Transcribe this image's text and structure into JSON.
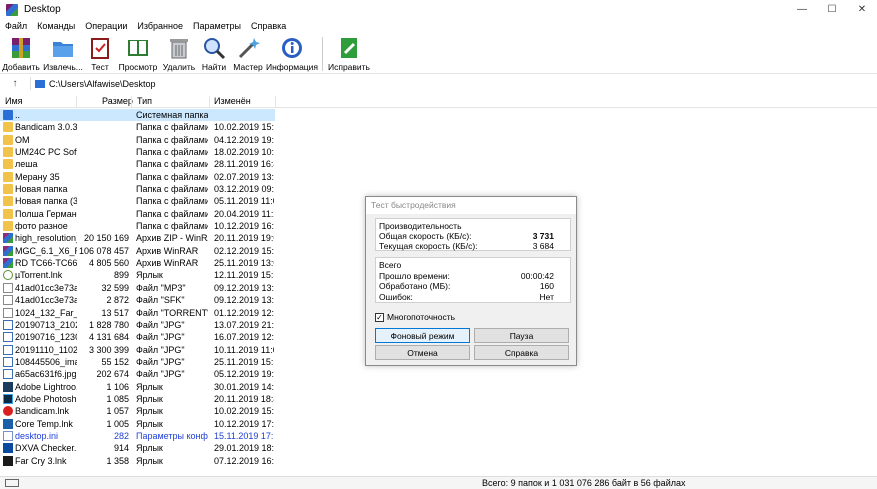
{
  "window": {
    "title": "Desktop",
    "controls": {
      "minimize": "—",
      "maximize": "☐",
      "close": "✕"
    }
  },
  "menu": [
    "Файл",
    "Команды",
    "Операции",
    "Избранное",
    "Параметры",
    "Справка"
  ],
  "toolbar": [
    {
      "label": "Добавить",
      "icon": "archive-add-icon"
    },
    {
      "label": "Извлечь...",
      "icon": "extract-folder-icon"
    },
    {
      "label": "Тест",
      "icon": "test-clipboard-icon"
    },
    {
      "label": "Просмотр",
      "icon": "view-book-icon"
    },
    {
      "label": "Удалить",
      "icon": "trash-icon"
    },
    {
      "label": "Найти",
      "icon": "magnifier-icon"
    },
    {
      "label": "Мастер",
      "icon": "wizard-wand-icon"
    },
    {
      "label": "Информация",
      "icon": "info-icon"
    },
    {
      "label": "Исправить",
      "icon": "repair-icon"
    }
  ],
  "address": {
    "path": "C:\\Users\\Alfawise\\Desktop",
    "up_glyph": "↑"
  },
  "columns": {
    "name": "Имя",
    "size": "Размер",
    "type": "Тип",
    "modified": "Изменён"
  },
  "files": [
    {
      "name": "..",
      "size": "",
      "type": "Системная папка",
      "date": "",
      "icon": "folder-up-icon"
    },
    {
      "name": "Bandicam 3.0.3....",
      "size": "",
      "type": "Папка с файлами",
      "date": "10.02.2019 15:43",
      "icon": "folder-icon"
    },
    {
      "name": "OM",
      "size": "",
      "type": "Папка с файлами",
      "date": "04.12.2019 19:21",
      "icon": "folder-icon"
    },
    {
      "name": "UM24C PC Soft...",
      "size": "",
      "type": "Папка с файлами",
      "date": "18.02.2019 10:10",
      "icon": "folder-icon"
    },
    {
      "name": "леша",
      "size": "",
      "type": "Папка с файлами",
      "date": "28.11.2019 16:44",
      "icon": "folder-icon"
    },
    {
      "name": "Мерану 35",
      "size": "",
      "type": "Папка с файлами",
      "date": "02.07.2019 13:15",
      "icon": "folder-icon"
    },
    {
      "name": "Новая папка",
      "size": "",
      "type": "Папка с файлами",
      "date": "03.12.2019 09:15",
      "icon": "folder-icon"
    },
    {
      "name": "Новая папка (3)",
      "size": "",
      "type": "Папка с файлами",
      "date": "05.11.2019 11:08",
      "icon": "folder-icon"
    },
    {
      "name": "Полша Герман...",
      "size": "",
      "type": "Папка с файлами",
      "date": "20.04.2019 11:26",
      "icon": "folder-icon"
    },
    {
      "name": "фото разное",
      "size": "",
      "type": "Папка с файлами",
      "date": "10.12.2019 16:59",
      "icon": "folder-icon"
    },
    {
      "name": "high_resolution_...",
      "size": "20 150 169",
      "type": "Архив ZIP - WinRAR",
      "date": "20.11.2019 19:07",
      "icon": "winrar-archive-icon"
    },
    {
      "name": "MGC_6.1_X6_RN...",
      "size": "106 078 457",
      "type": "Архив WinRAR",
      "date": "02.12.2019 15:02",
      "icon": "winrar-archive-icon"
    },
    {
      "name": "RD TC66-TC66C ...",
      "size": "4 805 560",
      "type": "Архив WinRAR",
      "date": "25.11.2019 13:02",
      "icon": "winrar-archive-icon"
    },
    {
      "name": "µTorrent.lnk",
      "size": "899",
      "type": "Ярлык",
      "date": "12.11.2019 15:50",
      "icon": "utorrent-icon"
    },
    {
      "name": "41ad01cc3e73a1...",
      "size": "32 599",
      "type": "Файл \"MP3\"",
      "date": "09.12.2019 13:33",
      "icon": "file-icon"
    },
    {
      "name": "41ad01cc3e73a1...",
      "size": "2 872",
      "type": "Файл \"SFK\"",
      "date": "09.12.2019 13:33",
      "icon": "file-icon"
    },
    {
      "name": "1024_132_Far_Cr...",
      "size": "13 517",
      "type": "Файл \"TORRENT\"",
      "date": "01.12.2019 12:33",
      "icon": "torrent-file-icon"
    },
    {
      "name": "20190713_21022...",
      "size": "1 828 780",
      "type": "Файл \"JPG\"",
      "date": "13.07.2019 21:02",
      "icon": "image-icon"
    },
    {
      "name": "20190716_12302...",
      "size": "4 131 684",
      "type": "Файл \"JPG\"",
      "date": "16.07.2019 12:30",
      "icon": "image-icon"
    },
    {
      "name": "20191110_11022...",
      "size": "3 300 399",
      "type": "Файл \"JPG\"",
      "date": "10.11.2019 11:02",
      "icon": "image-icon"
    },
    {
      "name": "108445506_imag...",
      "size": "55 152",
      "type": "Файл \"JPG\"",
      "date": "25.11.2019 15:56",
      "icon": "image-icon"
    },
    {
      "name": "a65ac631f6.jpg",
      "size": "202 674",
      "type": "Файл \"JPG\"",
      "date": "05.12.2019 19:57",
      "icon": "image-icon"
    },
    {
      "name": "Adobe Lightroo...",
      "size": "1 106",
      "type": "Ярлык",
      "date": "30.01.2019 14:08",
      "icon": "lightroom-icon"
    },
    {
      "name": "Adobe Photosh...",
      "size": "1 085",
      "type": "Ярлык",
      "date": "20.11.2019 18:44",
      "icon": "photoshop-icon"
    },
    {
      "name": "Bandicam.lnk",
      "size": "1 057",
      "type": "Ярлык",
      "date": "10.02.2019 15:45",
      "icon": "bandicam-icon"
    },
    {
      "name": "Core Temp.lnk",
      "size": "1 005",
      "type": "Ярлык",
      "date": "10.12.2019 17:20",
      "icon": "coretemp-icon"
    },
    {
      "name": "desktop.ini",
      "size": "282",
      "type": "Параметры конф...",
      "date": "15.11.2019 17:16",
      "icon": "ini-file-icon",
      "highlight": "#1f3fd6"
    },
    {
      "name": "DXVA Checker.lnk",
      "size": "914",
      "type": "Ярлык",
      "date": "29.01.2019 18:42",
      "icon": "dxva-icon"
    },
    {
      "name": "Far Cry 3.lnk",
      "size": "1 358",
      "type": "Ярлык",
      "date": "07.12.2019 16:05",
      "icon": "farcry-icon"
    }
  ],
  "status": {
    "text": "Всего: 9 папок и 1 031 076 286 байт в 56 файлах"
  },
  "benchmark": {
    "title": "Тест быстродействия",
    "perf_group": "Производительность",
    "total_speed_label": "Общая скорость (КБ/с):",
    "total_speed_value": "3 731",
    "current_speed_label": "Текущая скорость (КБ/с):",
    "current_speed_value": "3 684",
    "total_group": "Всего",
    "elapsed_label": "Прошло времени:",
    "elapsed_value": "00:00:42",
    "processed_label": "Обработано (МБ):",
    "processed_value": "160",
    "errors_label": "Ошибок:",
    "errors_value": "Нет",
    "multithread_label": "Многопоточность",
    "multithread_checked": "✓",
    "bg_button": "Фоновый режим",
    "pause_button": "Пауза",
    "cancel_button": "Отмена",
    "help_button": "Справка"
  }
}
